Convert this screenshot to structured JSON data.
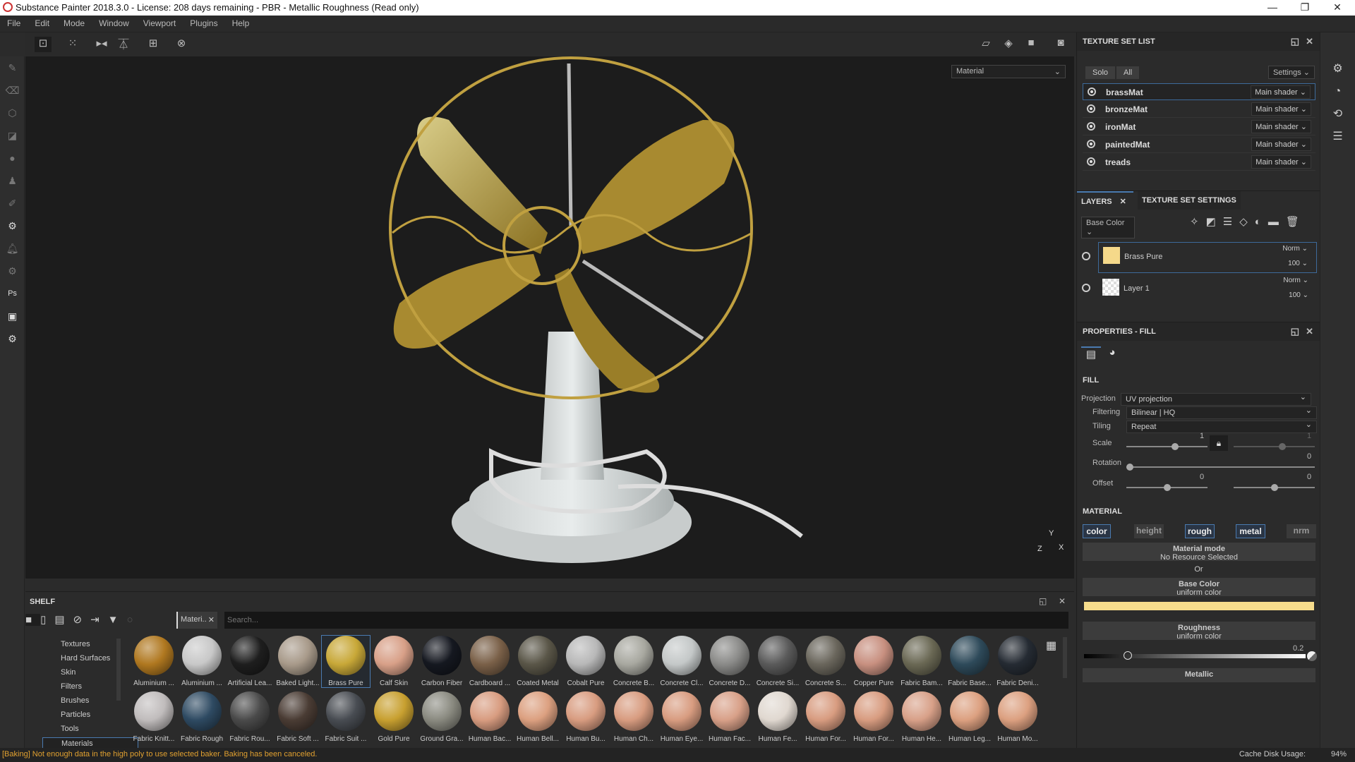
{
  "window": {
    "title": "Substance Painter 2018.3.0 - License: 208 days remaining - PBR - Metallic Roughness (Read only)",
    "minimize": "—",
    "restore": "❐",
    "close": "✕"
  },
  "menu": [
    "File",
    "Edit",
    "Mode",
    "Window",
    "Viewport",
    "Plugins",
    "Help"
  ],
  "viewport": {
    "mode": "Material",
    "axis_y": "Y",
    "axis_x": "X",
    "axis_z": "Z"
  },
  "texture_set_list": {
    "title": "TEXTURE SET LIST",
    "solo": "Solo",
    "all": "All",
    "settings": "Settings ⌄",
    "items": [
      {
        "name": "brassMat",
        "shader": "Main shader ⌄"
      },
      {
        "name": "bronzeMat",
        "shader": "Main shader ⌄"
      },
      {
        "name": "ironMat",
        "shader": "Main shader ⌄"
      },
      {
        "name": "paintedMat",
        "shader": "Main shader ⌄"
      },
      {
        "name": "treads",
        "shader": "Main shader ⌄"
      }
    ]
  },
  "layers": {
    "tab_layers": "LAYERS",
    "tab_tss": "TEXTURE SET SETTINGS",
    "channel": "Base Color",
    "items": [
      {
        "name": "Brass Pure",
        "blend": "Norm ⌄",
        "opacity": "100 ⌄",
        "color": "#f5d98a"
      },
      {
        "name": "Layer 1",
        "blend": "Norm ⌄",
        "opacity": "100 ⌄"
      }
    ]
  },
  "properties": {
    "title": "PROPERTIES - FILL",
    "fill": "FILL",
    "projection_label": "Projection",
    "projection": "UV projection",
    "filtering_label": "Filtering",
    "filtering": "Bilinear | HQ",
    "tiling_label": "Tiling",
    "tiling": "Repeat",
    "scale_label": "Scale",
    "scale_u": "1",
    "scale_v": "1",
    "rotation_label": "Rotation",
    "rotation": "0",
    "offset_label": "Offset",
    "offset_u": "0",
    "offset_v": "0",
    "material": "MATERIAL",
    "chips": [
      "color",
      "height",
      "rough",
      "metal",
      "nrm"
    ],
    "material_mode": "Material mode",
    "no_resource": "No Resource Selected",
    "or": "Or",
    "base_color": "Base Color",
    "base_color_sub": "uniform color",
    "base_color_value": "#f6dc8c",
    "roughness": "Roughness",
    "roughness_sub": "uniform color",
    "roughness_value": "0.2",
    "metallic": "Metallic"
  },
  "shelf": {
    "title": "SHELF",
    "filter_tag": "Materi..",
    "search_placeholder": "Search...",
    "categories": [
      "Textures",
      "Hard Surfaces",
      "Skin",
      "Filters",
      "Brushes",
      "Particles",
      "Tools",
      "Materials"
    ],
    "selected_category": "Materials",
    "materials": [
      {
        "name": "Aluminium ...",
        "c": "#b07820"
      },
      {
        "name": "Aluminium ...",
        "c": "#c8c8c8"
      },
      {
        "name": "Artificial Lea...",
        "c": "#1e1e1e"
      },
      {
        "name": "Baked Light...",
        "c": "#a89a8a"
      },
      {
        "name": "Brass Pure",
        "c": "#c8a838"
      },
      {
        "name": "Calf Skin",
        "c": "#d8a088"
      },
      {
        "name": "Carbon Fiber",
        "c": "#151820"
      },
      {
        "name": "Cardboard ...",
        "c": "#7a6048"
      },
      {
        "name": "Coated Metal",
        "c": "#5a5648"
      },
      {
        "name": "Cobalt Pure",
        "c": "#b8b8b8"
      },
      {
        "name": "Concrete B...",
        "c": "#a8a8a0"
      },
      {
        "name": "Concrete Cl...",
        "c": "#c4c8c8"
      },
      {
        "name": "Concrete D...",
        "c": "#8a8a88"
      },
      {
        "name": "Concrete Si...",
        "c": "#5a5a5a"
      },
      {
        "name": "Concrete S...",
        "c": "#6a665c"
      },
      {
        "name": "Copper Pure",
        "c": "#c89080"
      },
      {
        "name": "Fabric Bam...",
        "c": "#6a6854"
      },
      {
        "name": "Fabric Base...",
        "c": "#2e4a5a"
      },
      {
        "name": "Fabric Deni...",
        "c": "#252b33"
      },
      {
        "name": "Fabric Knitt...",
        "c": "#c0bcbc"
      },
      {
        "name": "Fabric Rough",
        "c": "#2e4a62"
      },
      {
        "name": "Fabric Rou...",
        "c": "#4a4a4a"
      },
      {
        "name": "Fabric Soft ...",
        "c": "#4a3c34"
      },
      {
        "name": "Fabric Suit ...",
        "c": "#484c52"
      },
      {
        "name": "Gold Pure",
        "c": "#c8a030"
      },
      {
        "name": "Ground Gra...",
        "c": "#8a8a80"
      },
      {
        "name": "Human Bac...",
        "c": "#d89c80"
      },
      {
        "name": "Human Bell...",
        "c": "#dca080"
      },
      {
        "name": "Human Bu...",
        "c": "#d89c80"
      },
      {
        "name": "Human Ch...",
        "c": "#d89c80"
      },
      {
        "name": "Human Eye...",
        "c": "#d89c80"
      },
      {
        "name": "Human Fac...",
        "c": "#d8a088"
      },
      {
        "name": "Human Fe...",
        "c": "#e0d8d0"
      },
      {
        "name": "Human For...",
        "c": "#d89c80"
      },
      {
        "name": "Human For...",
        "c": "#d89c80"
      },
      {
        "name": "Human He...",
        "c": "#d8a088"
      },
      {
        "name": "Human Leg...",
        "c": "#dca080"
      },
      {
        "name": "Human Mo...",
        "c": "#dca080"
      }
    ],
    "selected_material": "Brass Pure"
  },
  "status": {
    "message": "[Baking] Not enough data in the high poly to use selected baker. Baking has been canceled.",
    "cache_label": "Cache Disk Usage:",
    "cache_value": "94%"
  },
  "colors": {
    "accent": "#4a7ab0",
    "warning": "#e0a030",
    "brass": "#c8a838"
  }
}
